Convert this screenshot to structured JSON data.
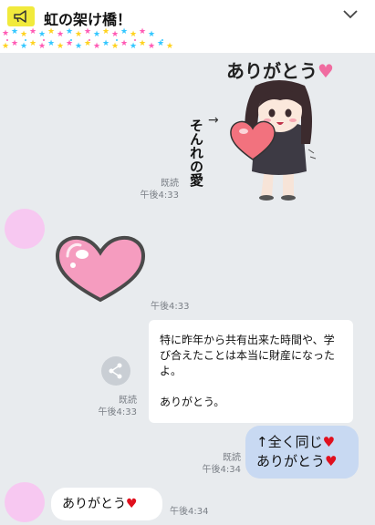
{
  "header": {
    "title": "虹の架け橋！"
  },
  "sticker1": {
    "thanks_text": "ありがとう",
    "arrow_text": "そんれの愛",
    "read": "既読",
    "time": "午後4:33"
  },
  "sticker2": {
    "time": "午後4:33"
  },
  "message1": {
    "text1": "特に昨年から共有出来た時間や、学び合えたことは本当に財産になったよ。",
    "text2": "ありがとう。",
    "read": "既読",
    "time": "午後4:33"
  },
  "message2": {
    "line1": "↑全く同じ",
    "line2": "ありがとう",
    "read": "既読",
    "time": "午後4:34"
  },
  "message3": {
    "text": "ありがとう",
    "time": "午後4:34"
  },
  "icons": {
    "megaphone": "megaphone-icon",
    "chevron": "chevron-down-icon",
    "share": "share-icon",
    "heart": "heart-icon"
  },
  "colors": {
    "background": "#e8ebee",
    "outgoing_bubble": "#c8d9f2",
    "incoming_bubble": "#ffffff",
    "avatar": "#f7c8f1",
    "heart_red": "#e0101e",
    "sticker_pink": "#f59cbf"
  }
}
